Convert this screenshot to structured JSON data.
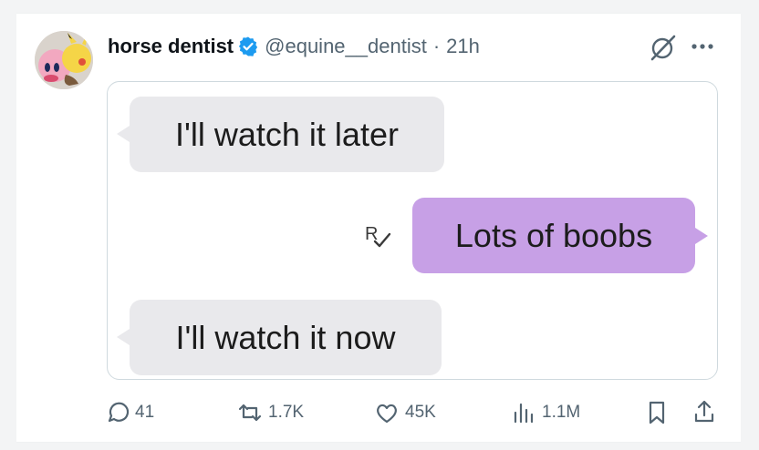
{
  "post": {
    "author": {
      "display_name": "horse dentist",
      "handle": "@equine__dentist",
      "verified": true,
      "verified_color": "#1d9bf0"
    },
    "separator": "·",
    "timestamp": "21h",
    "media": {
      "messages": [
        {
          "direction": "incoming",
          "text": "I'll watch it later"
        },
        {
          "direction": "outgoing",
          "text": "Lots of boobs",
          "status_mark": "read-receipt-icon"
        },
        {
          "direction": "incoming",
          "text": "I'll watch it now"
        }
      ],
      "incoming_color": "#e9e9ec",
      "outgoing_color": "#c7a0e6"
    },
    "actions": {
      "replies": "41",
      "reposts": "1.7K",
      "likes": "45K",
      "views": "1.1M"
    }
  },
  "icons": [
    "grok-icon",
    "more-options-icon",
    "reply-icon",
    "repost-icon",
    "like-icon",
    "views-icon",
    "bookmark-icon",
    "share-icon",
    "verified-badge-icon"
  ]
}
